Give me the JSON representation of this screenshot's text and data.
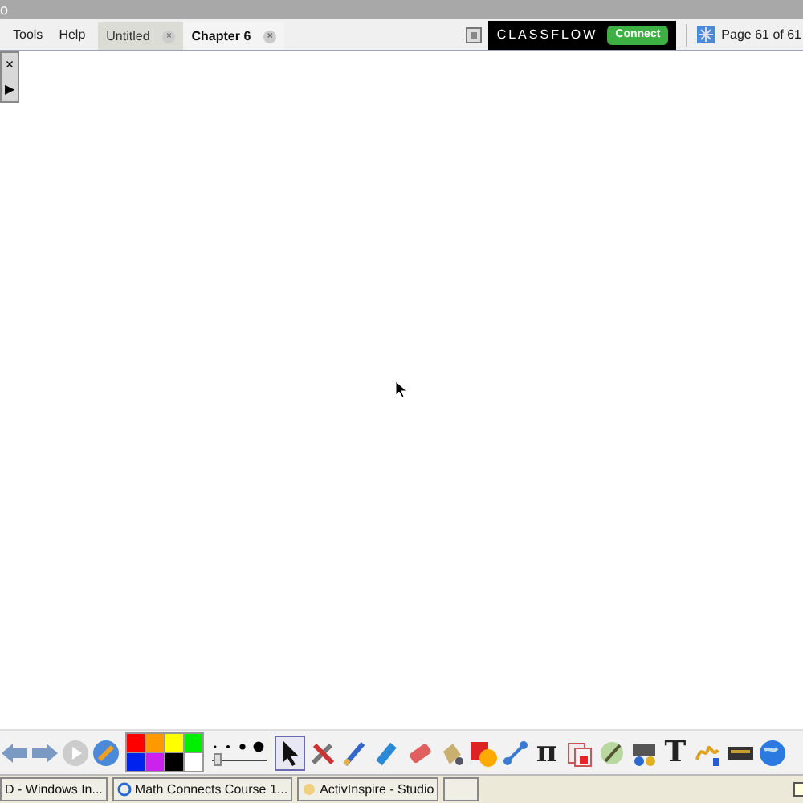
{
  "window": {
    "title": "o"
  },
  "menu": [
    "Tools",
    "Help"
  ],
  "tabs": [
    {
      "label": "Untitled",
      "selected": false,
      "close": "×"
    },
    {
      "label": "Chapter 6",
      "selected": true,
      "close": "×"
    }
  ],
  "classflow": {
    "brand": "CLASSFLOW",
    "button": "Connect"
  },
  "page_indicator": "Page 61 of 61",
  "float_panel": {
    "close": "×",
    "play": "▶"
  },
  "palette": [
    {
      "color": "#ff0000",
      "selected": false
    },
    {
      "color": "#ff9900",
      "selected": false
    },
    {
      "color": "#ffff00",
      "selected": false
    },
    {
      "color": "#00ee00",
      "selected": false
    },
    {
      "color": "#0022ee",
      "selected": false
    },
    {
      "color": "#cc22ee",
      "selected": false
    },
    {
      "color": "#000000",
      "selected": false
    },
    {
      "color": "#ffffff",
      "selected": false
    }
  ],
  "pen_width": {
    "level": 0.05
  },
  "tools": [
    {
      "kind": "select",
      "selected": true
    },
    {
      "kind": "tools",
      "selected": false
    },
    {
      "kind": "pen",
      "selected": false
    },
    {
      "kind": "highlighter",
      "selected": false
    },
    {
      "kind": "eraser",
      "selected": false
    },
    {
      "kind": "fill",
      "selected": false
    },
    {
      "kind": "shape",
      "selected": false
    },
    {
      "kind": "connector",
      "selected": false
    },
    {
      "kind": "glyph",
      "text": "π",
      "selected": false
    },
    {
      "kind": "resource",
      "selected": false
    },
    {
      "kind": "magic",
      "selected": false
    },
    {
      "kind": "media",
      "selected": false
    },
    {
      "kind": "glyph",
      "text": "T",
      "selected": false
    },
    {
      "kind": "handwriting",
      "selected": false
    },
    {
      "kind": "keyboard",
      "selected": false
    },
    {
      "kind": "globe",
      "selected": false
    }
  ],
  "taskbar": [
    {
      "label": "D - Windows In..."
    },
    {
      "label": "Math Connects Course 1..."
    },
    {
      "label": "ActivInspire - Studio"
    }
  ]
}
